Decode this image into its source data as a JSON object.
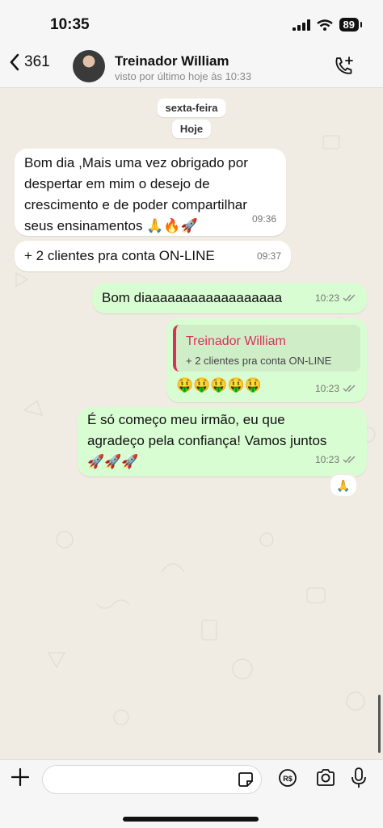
{
  "status_bar": {
    "time": "10:35",
    "battery": "89"
  },
  "header": {
    "back_count": "361",
    "contact_name": "Treinador William",
    "last_seen": "visto por último hoje às 10:33"
  },
  "chat": {
    "date_label": "sexta-feira",
    "today_label": "Hoje",
    "messages": [
      {
        "direction": "in",
        "lines": [
          "Bom dia ,Mais uma vez obrigado por",
          "despertar em mim o desejo de",
          "crescimento e de poder compartilhar",
          "seus ensinamentos 🙏🔥🚀"
        ],
        "time": "09:36"
      },
      {
        "direction": "in",
        "text": "+ 2 clientes pra conta ON-LINE",
        "time": "09:37"
      },
      {
        "direction": "out",
        "text": "Bom diaaaaaaaaaaaaaaaaaa",
        "time": "10:23"
      },
      {
        "direction": "out",
        "quote_author": "Treinador William",
        "quote_text": "+ 2 clientes pra conta ON-LINE",
        "text": "🤑🤑🤑🤑🤑",
        "time": "10:23"
      },
      {
        "direction": "out",
        "lines": [
          "É só começo meu irmão, eu que",
          "agradeço pela confiança! Vamos juntos",
          "🚀🚀🚀"
        ],
        "time": "10:23",
        "reaction": "🙏"
      }
    ]
  },
  "input_bar": {
    "placeholder": ""
  },
  "colors": {
    "bubble_out": "#d9fdd3",
    "bubble_in": "#ffffff",
    "quote_accent": "#d9315a",
    "chat_bg": "#f1ece3"
  }
}
